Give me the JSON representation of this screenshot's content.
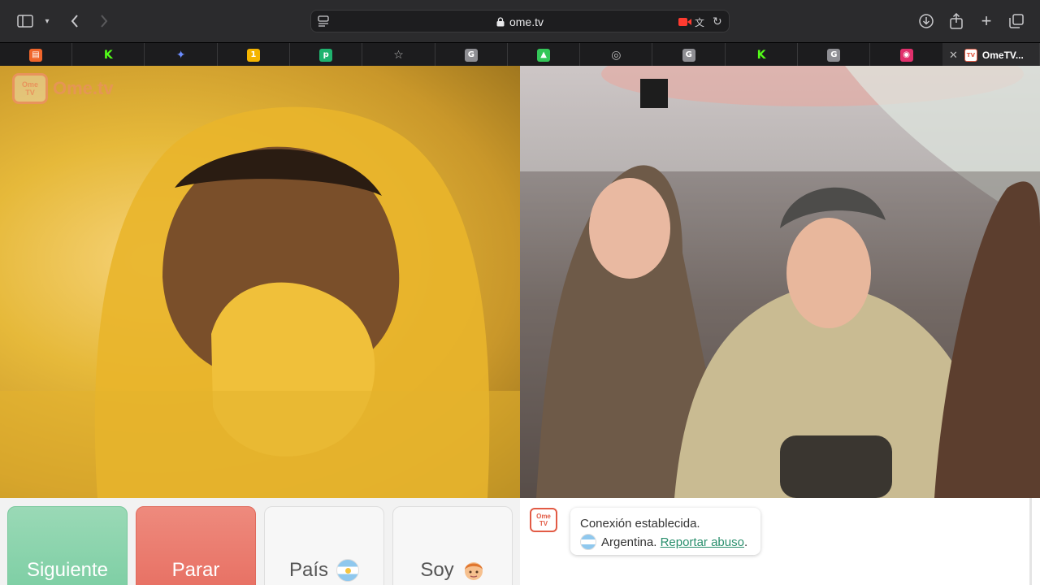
{
  "browser": {
    "url": "ome.tv",
    "active_tab_title": "OmeTV...",
    "tabs": [
      {
        "icon": "orange-app-icon",
        "color": "#f0652b",
        "glyph": "▤"
      },
      {
        "icon": "kick-icon",
        "color": "#53fc18",
        "glyph": "K"
      },
      {
        "icon": "gemini-icon",
        "color": "#6b8cff",
        "glyph": "✦"
      },
      {
        "icon": "colorful-1-icon",
        "color": "#f4b400",
        "glyph": "1"
      },
      {
        "icon": "psd-icon",
        "color": "#1fb36f",
        "glyph": "p"
      },
      {
        "icon": "star-icon",
        "color": "#bbbbbb",
        "glyph": "☆"
      },
      {
        "icon": "g-icon",
        "color": "#8e8e93",
        "glyph": "G"
      },
      {
        "icon": "image-icon",
        "color": "#34c759",
        "glyph": "▲"
      },
      {
        "icon": "compass-icon",
        "color": "#bbbbbb",
        "glyph": "◎"
      },
      {
        "icon": "g-icon",
        "color": "#8e8e93",
        "glyph": "G"
      },
      {
        "icon": "kick-icon",
        "color": "#53fc18",
        "glyph": "K"
      },
      {
        "icon": "g-icon",
        "color": "#8e8e93",
        "glyph": "G"
      },
      {
        "icon": "instagram-icon",
        "color": "#e1306c",
        "glyph": "◉"
      }
    ]
  },
  "logo": {
    "badge_top": "Ome",
    "badge_bottom": "TV",
    "text": "Ome.tv"
  },
  "controls": {
    "next_label": "Siguiente",
    "stop_label": "Parar",
    "country_label": "País",
    "gender_label": "Soy"
  },
  "chat": {
    "avatar_top": "Ome",
    "avatar_bottom": "TV",
    "status": "Conexión establecida.",
    "country": "Argentina.",
    "report_link": "Reportar abuso",
    "report_suffix": "."
  },
  "colors": {
    "next": "#7ccea3",
    "stop": "#e76f62",
    "link": "#2a8f6d",
    "brand": "#e8935c"
  }
}
